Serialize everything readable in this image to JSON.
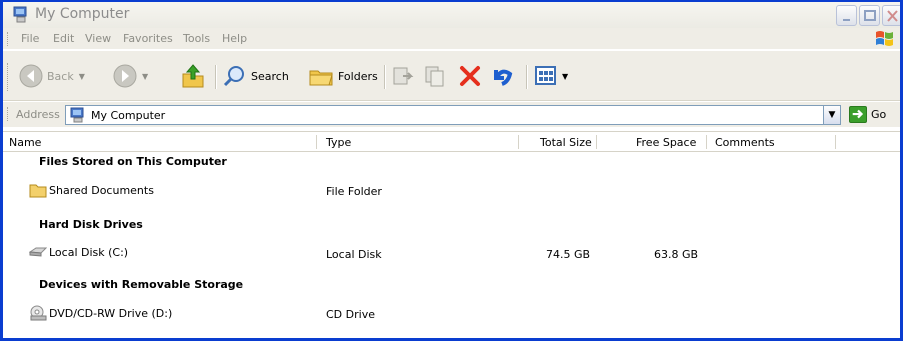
{
  "window": {
    "title": "My Computer"
  },
  "menu": [
    "File",
    "Edit",
    "View",
    "Favorites",
    "Tools",
    "Help"
  ],
  "toolbar": {
    "back": "Back",
    "search": "Search",
    "folders": "Folders"
  },
  "address": {
    "label": "Address",
    "value": "My Computer",
    "go": "Go"
  },
  "columns": [
    "Name",
    "Type",
    "Total Size",
    "Free Space",
    "Comments"
  ],
  "groups": [
    {
      "title": "Files Stored on This Computer",
      "items": [
        {
          "name": "Shared Documents",
          "type": "File Folder",
          "total": "",
          "free": ""
        }
      ]
    },
    {
      "title": "Hard Disk Drives",
      "items": [
        {
          "name": "Local Disk (C:)",
          "type": "Local Disk",
          "total": "74.5 GB",
          "free": "63.8 GB"
        }
      ]
    },
    {
      "title": "Devices with Removable Storage",
      "items": [
        {
          "name": "DVD/CD-RW Drive (D:)",
          "type": "CD Drive",
          "total": "",
          "free": ""
        }
      ]
    }
  ],
  "colors": {
    "frame": "#0a3dd0",
    "bar": "#efede6",
    "disabled_text": "#8d8d86"
  }
}
